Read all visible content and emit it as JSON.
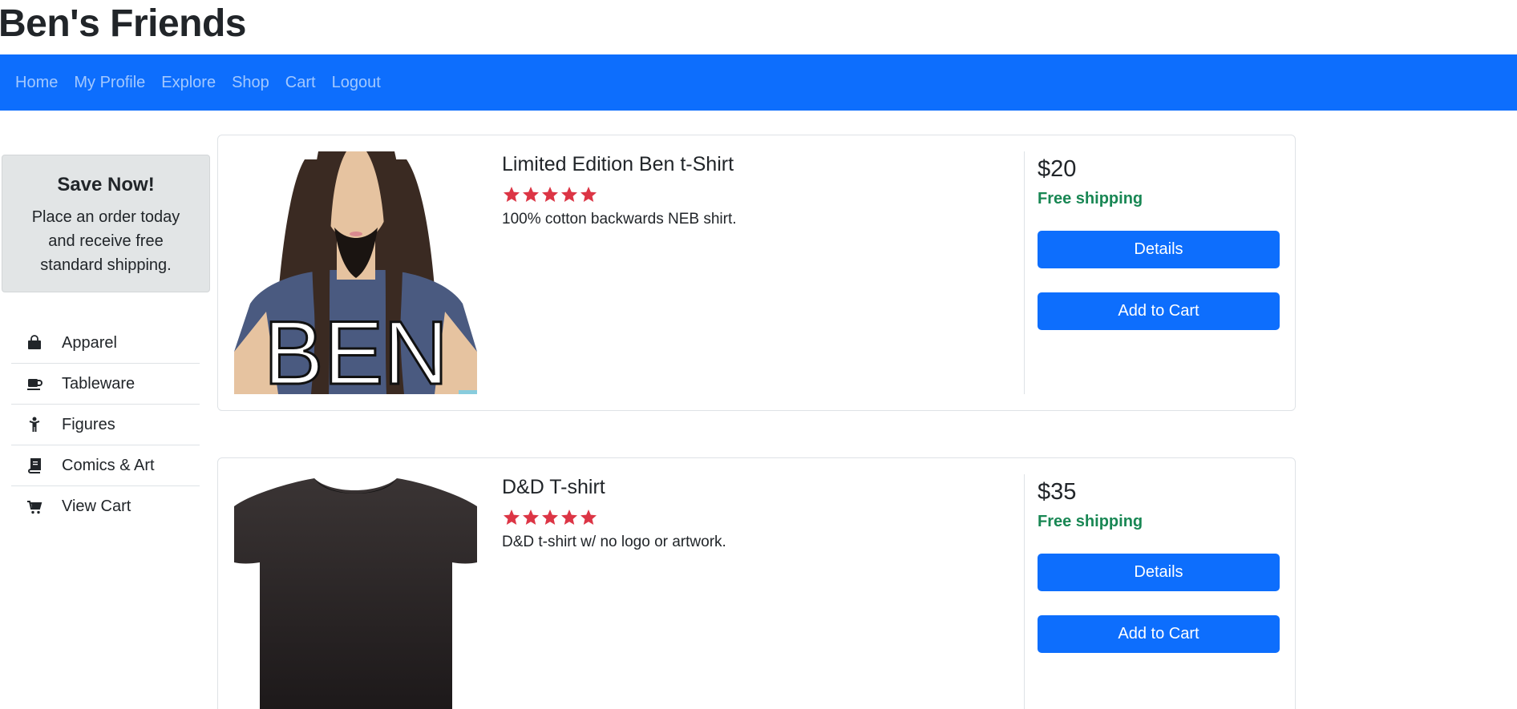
{
  "site": {
    "title": "Ben's Friends"
  },
  "nav": {
    "items": [
      "Home",
      "My Profile",
      "Explore",
      "Shop",
      "Cart",
      "Logout"
    ]
  },
  "promo": {
    "title": "Save Now!",
    "text": "Place an order today and receive free standard shipping."
  },
  "categories": [
    {
      "label": "Apparel",
      "icon": "shopping-bag-icon"
    },
    {
      "label": "Tableware",
      "icon": "mug-icon"
    },
    {
      "label": "Figures",
      "icon": "child-figure-icon"
    },
    {
      "label": "Comics & Art",
      "icon": "book-icon"
    },
    {
      "label": "View Cart",
      "icon": "cart-icon"
    }
  ],
  "products": [
    {
      "name": "Limited Edition Ben t-Shirt",
      "rating": 5,
      "description": "100% cotton backwards NEB shirt.",
      "price": "$20",
      "shipping": "Free shipping",
      "details_label": "Details",
      "add_label": "Add to Cart",
      "image_text": "BEN"
    },
    {
      "name": "D&D T-shirt",
      "rating": 5,
      "description": "D&D t-shirt w/ no logo or artwork.",
      "price": "$35",
      "shipping": "Free shipping",
      "details_label": "Details",
      "add_label": "Add to Cart"
    }
  ],
  "colors": {
    "primary": "#0d6efd",
    "success": "#198754",
    "star": "#dc3545",
    "promo_bg": "#e2e5e6"
  }
}
